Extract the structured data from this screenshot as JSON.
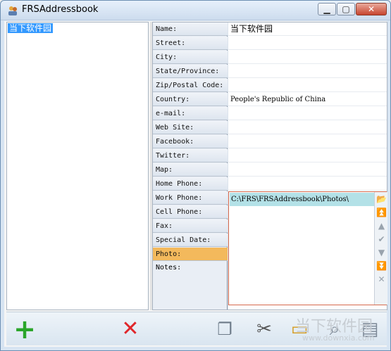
{
  "window": {
    "title": "FRSAddressbook",
    "minimize": "▁",
    "maximize": "▢",
    "close": "✕"
  },
  "contacts": [
    "当下软件园"
  ],
  "fields": [
    {
      "label": "Name:",
      "value": "当下软件园"
    },
    {
      "label": "Street:",
      "value": ""
    },
    {
      "label": "City:",
      "value": ""
    },
    {
      "label": "State/Province:",
      "value": ""
    },
    {
      "label": "Zip/Postal Code:",
      "value": ""
    },
    {
      "label": "Country:",
      "value": "People's Republic of China"
    },
    {
      "label": "e-mail:",
      "value": ""
    },
    {
      "label": "Web Site:",
      "value": ""
    },
    {
      "label": "Facebook:",
      "value": ""
    },
    {
      "label": "Twitter:",
      "value": ""
    },
    {
      "label": "Map:",
      "value": ""
    },
    {
      "label": "Home Phone:",
      "value": ""
    },
    {
      "label": "Work Phone:",
      "value": ""
    },
    {
      "label": "Cell Phone:",
      "value": ""
    },
    {
      "label": "Fax:",
      "value": ""
    },
    {
      "label": "Special Date:",
      "value": ""
    },
    {
      "label": "Photo:",
      "value": ""
    },
    {
      "label": "Notes:",
      "value": ""
    }
  ],
  "photo": {
    "path": "C:\\FRS\\FRSAddressbook\\Photos\\"
  },
  "icons": {
    "add": "+",
    "delete": "✕",
    "copy": "❐",
    "cut": "✂",
    "open": "▭",
    "search": "⌕",
    "print": "▤",
    "browse": "📂",
    "first": "⏫",
    "prev": "▲",
    "check": "✔",
    "next": "▼",
    "last": "⏬",
    "cancel": "✕"
  },
  "watermark": {
    "brand": "当下软件园",
    "url": "www.downxia.com"
  },
  "colors": {
    "selection": "#3399ff",
    "active_field": "#f3b95c",
    "photo_path_bg": "#b3e1e7",
    "add_green": "#2aa52a",
    "delete_red": "#e0262a"
  }
}
